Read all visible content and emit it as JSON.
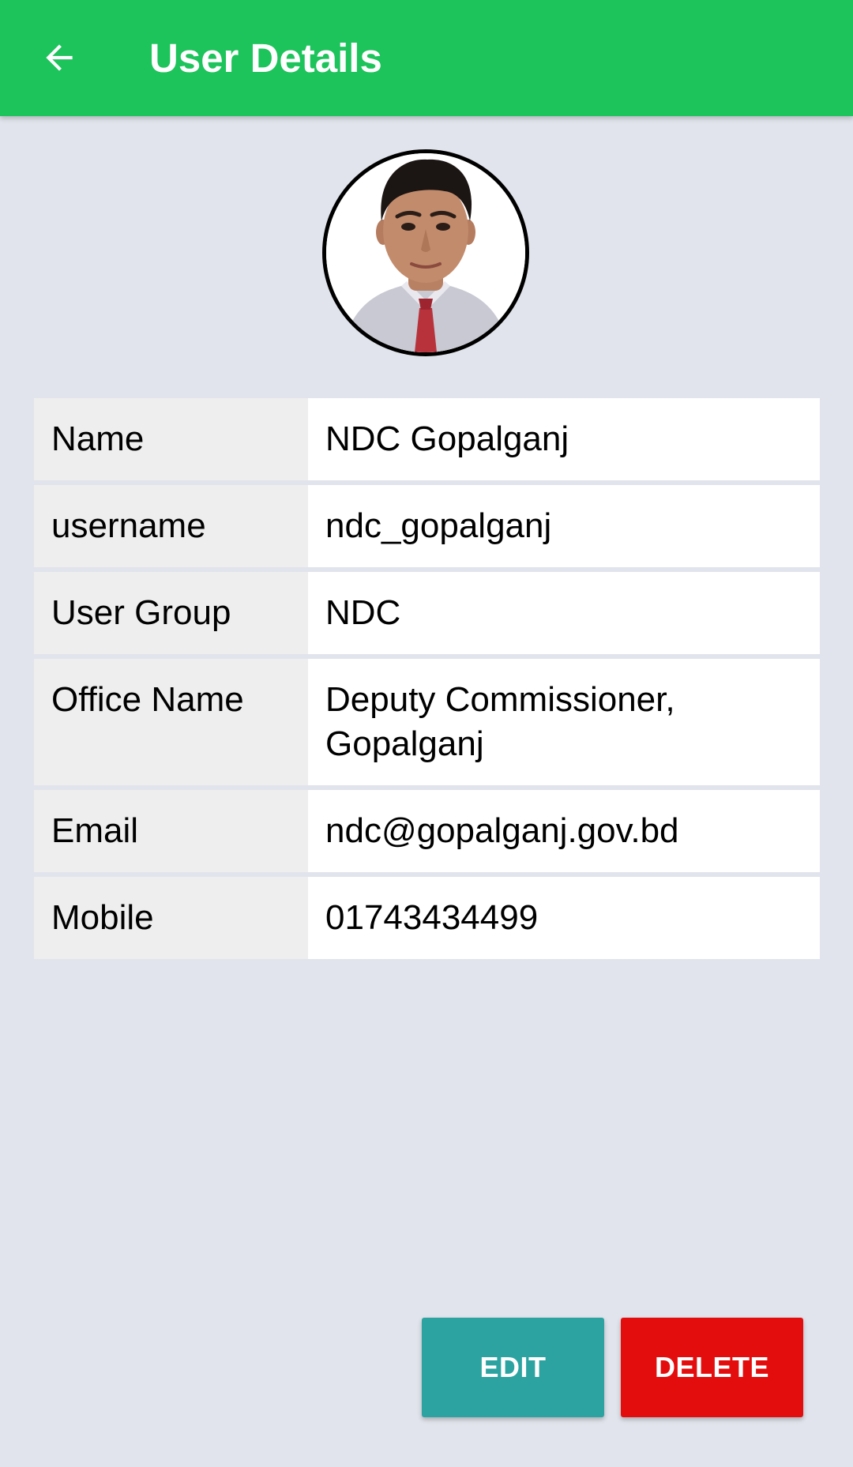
{
  "app_bar": {
    "title": "User Details",
    "back_icon": "arrow-left-icon",
    "color": "#1dc35b"
  },
  "avatar": {
    "alt": "user-photo"
  },
  "details": [
    {
      "label": "Name",
      "value": "NDC Gopalganj"
    },
    {
      "label": "username",
      "value": "ndc_gopalganj"
    },
    {
      "label": "User Group",
      "value": "NDC"
    },
    {
      "label": "Office Name",
      "value": "Deputy Commissioner, Gopalganj"
    },
    {
      "label": "Email",
      "value": "ndc@gopalganj.gov.bd"
    },
    {
      "label": "Mobile",
      "value": "01743434499"
    }
  ],
  "actions": {
    "edit_label": "EDIT",
    "delete_label": "DELETE",
    "edit_color": "#2ca3a1",
    "delete_color": "#e40d0d"
  }
}
